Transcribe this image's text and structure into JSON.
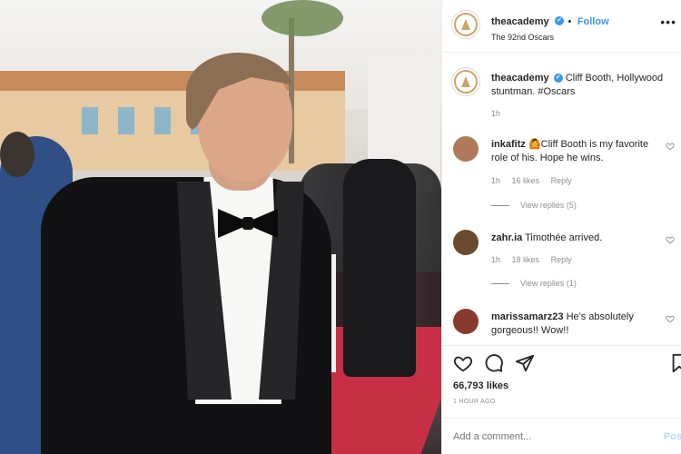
{
  "post": {
    "username": "theacademy",
    "follow_label": "Follow",
    "location": "The 92nd Oscars",
    "more_label": "•••"
  },
  "caption": {
    "username": "theacademy",
    "text": "Cliff Booth, Hollywood stuntman. #Oscars",
    "time": "1h"
  },
  "comments": [
    {
      "username": "inkafitz",
      "emoji": "🙆",
      "text": "Cliff Booth is my favorite role of his. Hope he wins.",
      "time": "1h",
      "likes": "16 likes",
      "reply_label": "Reply",
      "view_replies": "View replies (5)",
      "avatar_color": "#b07a5a"
    },
    {
      "username": "zahr.ia",
      "emoji": "",
      "text": "Timothée arrived.",
      "time": "1h",
      "likes": "18 likes",
      "reply_label": "Reply",
      "view_replies": "View replies (1)",
      "avatar_color": "#6b4b2e"
    },
    {
      "username": "marissamarz23",
      "emoji": "",
      "text": "He's absolutely gorgeous!! Wow!!",
      "time": "",
      "likes": "",
      "reply_label": "",
      "view_replies": "",
      "avatar_color": "#8a3a2c"
    }
  ],
  "actions": {
    "likes": "66,793 likes",
    "ago": "1 HOUR AGO"
  },
  "add_comment": {
    "placeholder": "Add a comment...",
    "post_label": "Pos"
  },
  "colors": {
    "accent": "#3897f0",
    "border": "#efefef",
    "muted": "#8e8e8e"
  },
  "icons": [
    "more-icon",
    "heart-icon",
    "comment-icon",
    "share-icon",
    "bookmark-icon",
    "verified-icon"
  ]
}
